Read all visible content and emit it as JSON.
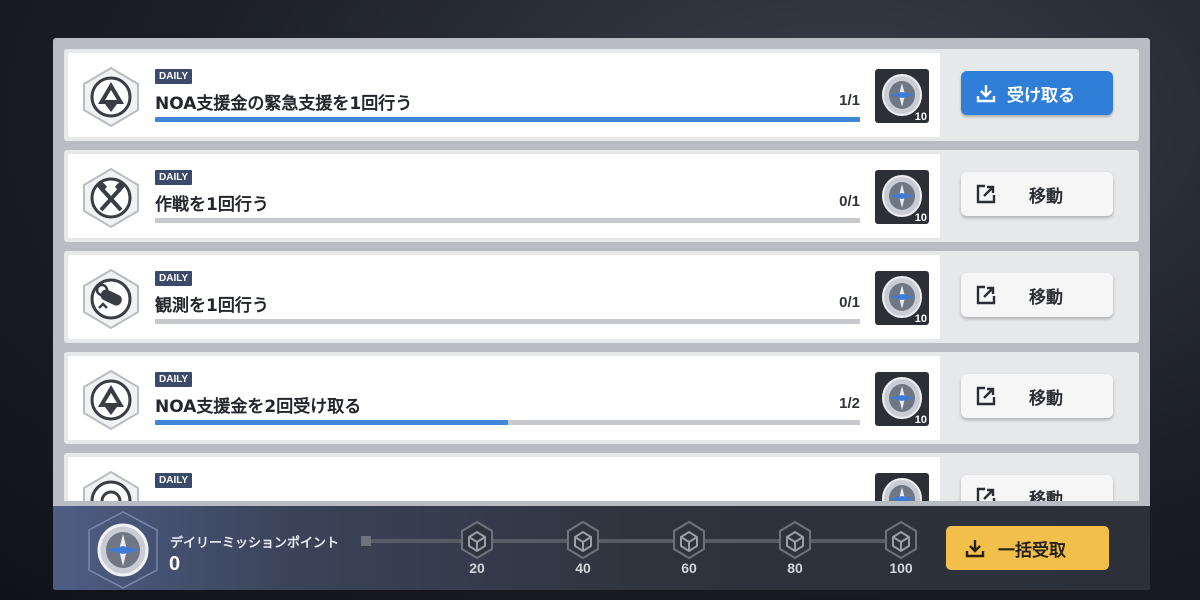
{
  "missions": [
    {
      "badge": "DAILY",
      "title": "NOA支援金の緊急支援を1回行う",
      "progress_text": "1/1",
      "progress": 1.0,
      "reward_qty": "10",
      "action_label": "受け取る",
      "action_type": "claim",
      "icon": "compass-rose-icon"
    },
    {
      "badge": "DAILY",
      "title": "作戦を1回行う",
      "progress_text": "0/1",
      "progress": 0.0,
      "reward_qty": "10",
      "action_label": "移動",
      "action_type": "move",
      "icon": "crossed-axes-icon"
    },
    {
      "badge": "DAILY",
      "title": "観測を1回行う",
      "progress_text": "0/1",
      "progress": 0.0,
      "reward_qty": "10",
      "action_label": "移動",
      "action_type": "move",
      "icon": "telescope-icon"
    },
    {
      "badge": "DAILY",
      "title": "NOA支援金を2回受け取る",
      "progress_text": "1/2",
      "progress": 0.5,
      "reward_qty": "10",
      "action_label": "移動",
      "action_type": "move",
      "icon": "compass-rose-icon"
    },
    {
      "badge": "DAILY",
      "title": "",
      "progress_text": "",
      "progress": 0.0,
      "reward_qty": "",
      "action_label": "移動",
      "action_type": "move",
      "icon": "target-icon"
    }
  ],
  "footer": {
    "label": "デイリーミッションポイント",
    "points": "0",
    "milestones": [
      "20",
      "40",
      "60",
      "80",
      "100"
    ],
    "collect_all_label": "一括受取"
  },
  "colors": {
    "accent_blue": "#2f7ed8",
    "progress_blue": "#3f86d9",
    "collect_yellow": "#f2c04a",
    "badge_navy": "#3b4a6b"
  }
}
